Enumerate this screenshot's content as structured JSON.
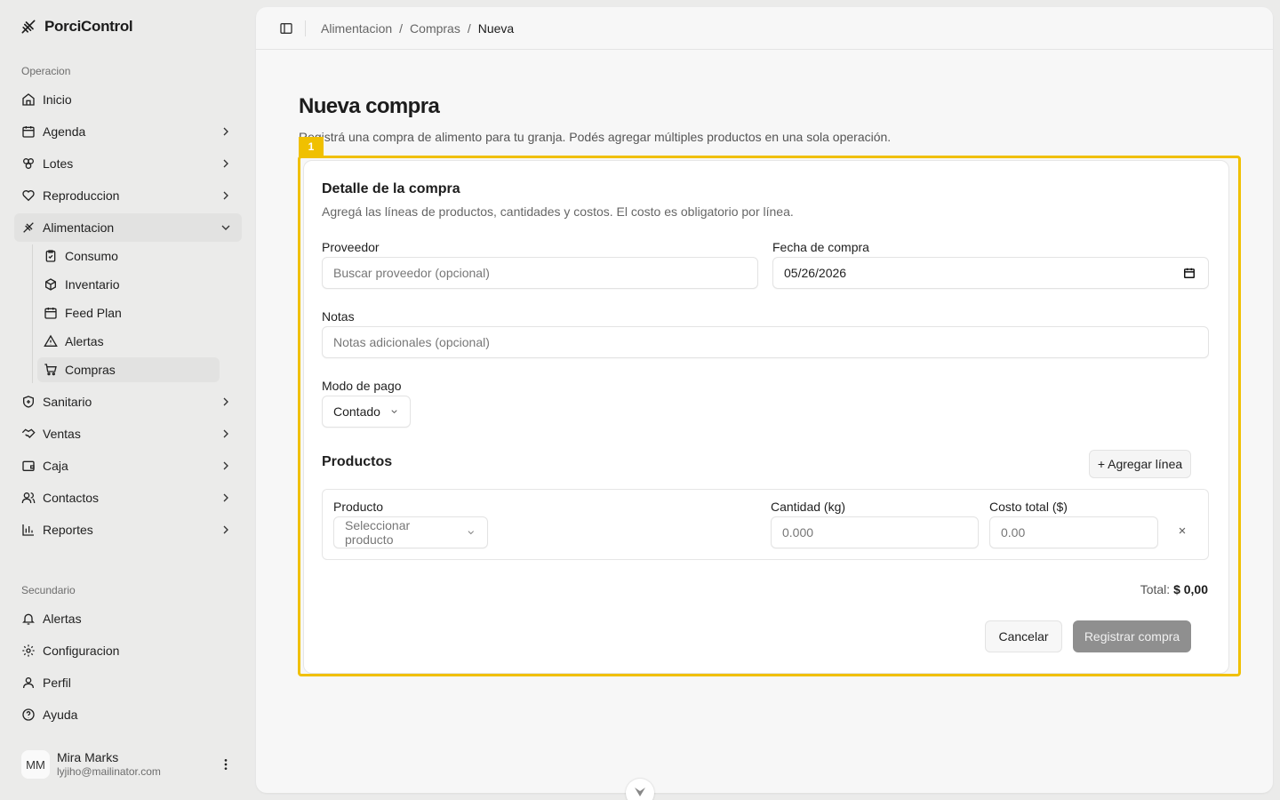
{
  "app": {
    "name": "PorciControl"
  },
  "sidebar": {
    "section_main": "Operacion",
    "items": [
      {
        "label": "Inicio",
        "icon": "home-icon",
        "chevron": false
      },
      {
        "label": "Agenda",
        "icon": "calendar-icon",
        "chevron": true
      },
      {
        "label": "Lotes",
        "icon": "lotes-icon",
        "chevron": true
      },
      {
        "label": "Reproduccion",
        "icon": "heart-icon",
        "chevron": true
      },
      {
        "label": "Alimentacion",
        "icon": "feed-icon",
        "chevron": true,
        "expanded": true
      }
    ],
    "subitems": [
      {
        "label": "Consumo",
        "icon": "clipboard-icon"
      },
      {
        "label": "Inventario",
        "icon": "package-icon"
      },
      {
        "label": "Feed Plan",
        "icon": "calendar-icon"
      },
      {
        "label": "Alertas",
        "icon": "warning-icon"
      },
      {
        "label": "Compras",
        "icon": "cart-icon",
        "active": true
      }
    ],
    "items_after": [
      {
        "label": "Sanitario",
        "icon": "shield-icon"
      },
      {
        "label": "Ventas",
        "icon": "handshake-icon"
      },
      {
        "label": "Caja",
        "icon": "wallet-icon"
      },
      {
        "label": "Contactos",
        "icon": "users-icon"
      },
      {
        "label": "Reportes",
        "icon": "chart-icon"
      }
    ],
    "section_secondary": "Secundario",
    "secondary_items": [
      {
        "label": "Alertas",
        "icon": "bell-icon"
      },
      {
        "label": "Configuracion",
        "icon": "gear-icon"
      },
      {
        "label": "Perfil",
        "icon": "user-icon"
      },
      {
        "label": "Ayuda",
        "icon": "help-icon"
      }
    ],
    "user": {
      "initials": "MM",
      "name": "Mira Marks",
      "email": "lyjiho@mailinator.com"
    }
  },
  "breadcrumb": {
    "items": [
      "Alimentacion",
      "Compras",
      "Nueva"
    ],
    "separator": "/"
  },
  "page": {
    "title": "Nueva compra",
    "subtitle": "Registrá una compra de alimento para tu granja. Podés agregar múltiples productos en una sola operación.",
    "marker": "1"
  },
  "form": {
    "title": "Detalle de la compra",
    "subtitle": "Agregá las líneas de productos, cantidades y costos. El costo es obligatorio por línea.",
    "proveedor_label": "Proveedor",
    "proveedor_placeholder": "Buscar proveedor (opcional)",
    "fecha_label": "Fecha de compra",
    "fecha_value": "05/26/2026",
    "notas_label": "Notas",
    "notas_placeholder": "Notas adicionales (opcional)",
    "pago_label": "Modo de pago",
    "pago_value": "Contado",
    "productos_title": "Productos",
    "add_line": "+ Agregar línea",
    "line": {
      "producto_label": "Producto",
      "producto_placeholder": "Seleccionar producto",
      "cantidad_label": "Cantidad (kg)",
      "cantidad_placeholder": "0.000",
      "costo_label": "Costo total ($)",
      "costo_placeholder": "0.00",
      "remove": "×"
    },
    "total_label": "Total:",
    "total_value": "$ 0,00",
    "cancel": "Cancelar",
    "submit": "Registrar compra"
  },
  "colors": {
    "highlight": "#f0c000",
    "disabled_button": "#8f8f8f"
  }
}
